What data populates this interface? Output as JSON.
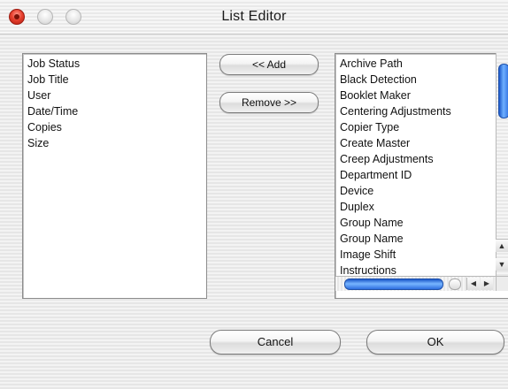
{
  "window": {
    "title": "List Editor"
  },
  "left_list": {
    "items": [
      "Job Status",
      "Job Title",
      "User",
      "Date/Time",
      "Copies",
      "Size"
    ]
  },
  "right_list": {
    "items": [
      "Archive Path",
      "Black Detection",
      "Booklet Maker",
      "Centering Adjustments",
      "Copier Type",
      "Create Master",
      "Creep Adjustments",
      "Department ID",
      "Device",
      "Duplex",
      "Group Name",
      "Group Name",
      "Image Shift",
      "Instructions"
    ]
  },
  "buttons": {
    "add": "<< Add",
    "remove": "Remove >>",
    "cancel": "Cancel",
    "ok": "OK"
  },
  "scroll": {
    "up_arrow": "▲",
    "down_arrow": "▼",
    "left_arrow": "◀",
    "right_arrow": "▶"
  },
  "colors": {
    "accent": "#2e6fe0",
    "close_button": "#e8412f"
  }
}
